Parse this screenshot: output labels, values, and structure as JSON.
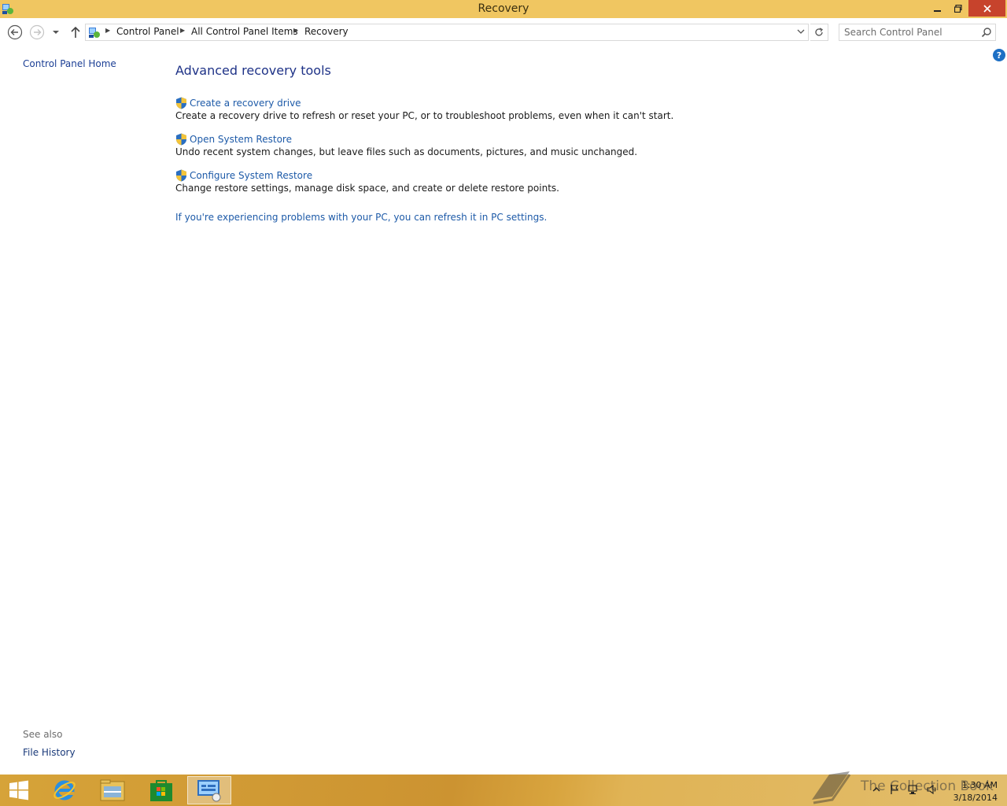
{
  "window": {
    "title": "Recovery",
    "controls": {
      "minimize_icon": "minimize-icon",
      "restore_icon": "restore-icon",
      "close_icon": "close-icon"
    }
  },
  "address_bar": {
    "breadcrumbs": [
      "Control Panel",
      "All Control Panel Items",
      "Recovery"
    ]
  },
  "search": {
    "placeholder": "Search Control Panel"
  },
  "sidebar": {
    "home_link": "Control Panel Home",
    "see_also_label": "See also",
    "see_also_links": [
      "File History"
    ]
  },
  "main": {
    "heading": "Advanced recovery tools",
    "tasks": [
      {
        "label": "Create a recovery drive",
        "description": "Create a recovery drive to refresh or reset your PC, or to troubleshoot problems, even when it can't start."
      },
      {
        "label": "Open System Restore",
        "description": "Undo recent system changes, but leave files such as documents, pictures, and music unchanged."
      },
      {
        "label": "Configure System Restore",
        "description": "Change restore settings, manage disk space, and create or delete restore points."
      }
    ],
    "pc_settings_link": "If you're experiencing problems with your PC, you can refresh it in PC settings."
  },
  "taskbar": {
    "items": [
      "start-icon",
      "internet-explorer-icon",
      "file-explorer-icon",
      "store-icon",
      "control-panel-icon"
    ],
    "active_item": "control-panel-icon",
    "time": "1:30 AM",
    "date": "3/18/2014",
    "watermark": "The Collection Book"
  },
  "colors": {
    "titlebar": "#f0c661",
    "close_button": "#c7432c",
    "link": "#1d5aa8",
    "heading": "#1e3287"
  }
}
